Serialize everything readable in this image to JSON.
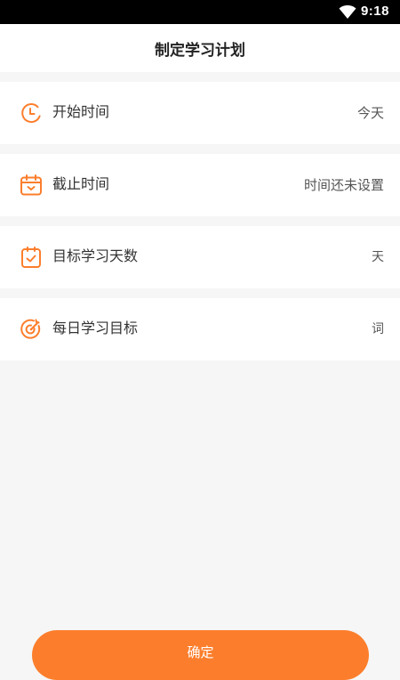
{
  "status_bar": {
    "time": "9:18",
    "icons": [
      "wifi-icon"
    ]
  },
  "header": {
    "title": "制定学习计划"
  },
  "rows": [
    {
      "label": "开始时间",
      "value": "今天",
      "icon": "clock-icon"
    },
    {
      "label": "截止时间",
      "value": "时间还未设置",
      "icon": "calendar-icon"
    },
    {
      "label": "目标学习天数",
      "value": "天",
      "icon": "calendar-check-icon"
    },
    {
      "label": "每日学习目标",
      "value": "词",
      "icon": "target-icon"
    }
  ],
  "confirm_button": {
    "label": "确定"
  },
  "colors": {
    "accent": "#fc7e2c",
    "background": "#f6f6f6",
    "card": "#ffffff"
  }
}
